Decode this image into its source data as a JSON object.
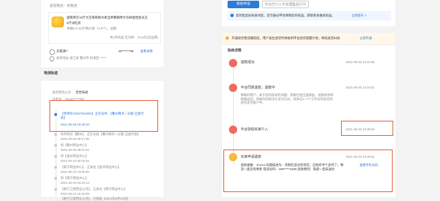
{
  "order": {
    "delivery_status": "退货物流：未物流",
    "product_title_l1": "越南青芒10斤大芒果新鲜水果当季整箱特大包邮金煌金龙玉",
    "product_title_l2": "5斤试吃装",
    "product_spec": "青檬8.5-10斤/精大果（4-8个），品精",
    "product_qty_price": "共1件商品  实付款：￥24元(含运费)",
    "buyer_name": "买家满**",
    "buyer_phone": "15*******98",
    "buyer_detail_link": "查看详情",
    "buyer_address": "收货地址:浙江省 衢州市 柯城区 *****"
  },
  "logistics": {
    "section_title": "物流轨迹",
    "company_label": "发货物流公司",
    "company_value": "百世快递",
    "tracking_line": "运单号：YD124*****80*",
    "events": [
      {
        "text": "【李钟华10057064091】正在派件，【衢州网点一分部·启金代表】",
        "time": "2021-06-29 15:40:10"
      },
      {
        "text": "快件到达【衢州】，正在派送【衢州网点一分部·启金代表】",
        "time": "2021-06-25 05:17:35"
      },
      {
        "text": "到【衢州转运中心】",
        "time": "2021-06-25 05:01:52"
      },
      {
        "text": "到【金华转运中心】",
        "time": "2021-06-24 05:20:31"
      },
      {
        "text": "【南宁转运中心】，正发往【金华转运中心】",
        "time": "2021-06-23 13:00:50"
      },
      {
        "text": "到【南宁转运中心】",
        "time": "2021-06-23 04:23:13"
      },
      {
        "text": "【南宁江南营业公司】，正发往【南宁转运中心】",
        "time": "2021-06-22 18:32:09"
      },
      {
        "text": "【南宁江南营业公司】，已揽收【2021年6月22日】",
        "time": ""
      }
    ]
  },
  "right": {
    "btn_primary": "修权申请",
    "btn_secondary": "平台已介入不处理售后行为",
    "notice_text": "您的售后协商关闭后，您可通过申诉保障您的权益。获取更多维权权益。",
    "notice_link": "立即提升 >",
    "tip_text": "开通退货物流跟踪后，用户发生退货时将收到平台退货提醒计划，降低退货纠纷",
    "tip_link": "立即开通",
    "history_title": "协商详情",
    "entries": [
      {
        "actor": "退款成功",
        "time": "2021-06-29 14:19:35",
        "body": ""
      },
      {
        "actor": "平台同意退款，退款中",
        "time": "2021-06-29 14:19:31",
        "body": "尊敬的用户，关于您的投诉的问题，客服已经全面调查，退款款项将原路返回，到账时间取决于支付方式，具体在1~7个工作日内退还到您的支付账户中。"
      },
      {
        "actor": "平台协助买家介入",
        "time": "2021-06-29 13:39:53",
        "body": ""
      },
      {
        "actor": "买家申请退款",
        "time": "2021-06-29 13:39:52",
        "body": "退款金额：￥24.0  问题描述为：货物在途没有到货，已经有半个多月了，物流一直没有更新  电话号码：159*****2490  退款原因：快递一直未送达",
        "link": "查看手机号码"
      }
    ]
  },
  "colors": {
    "accent": "#2d7bd8",
    "highlight": "#e0562c",
    "warning": "#f7a93b"
  }
}
